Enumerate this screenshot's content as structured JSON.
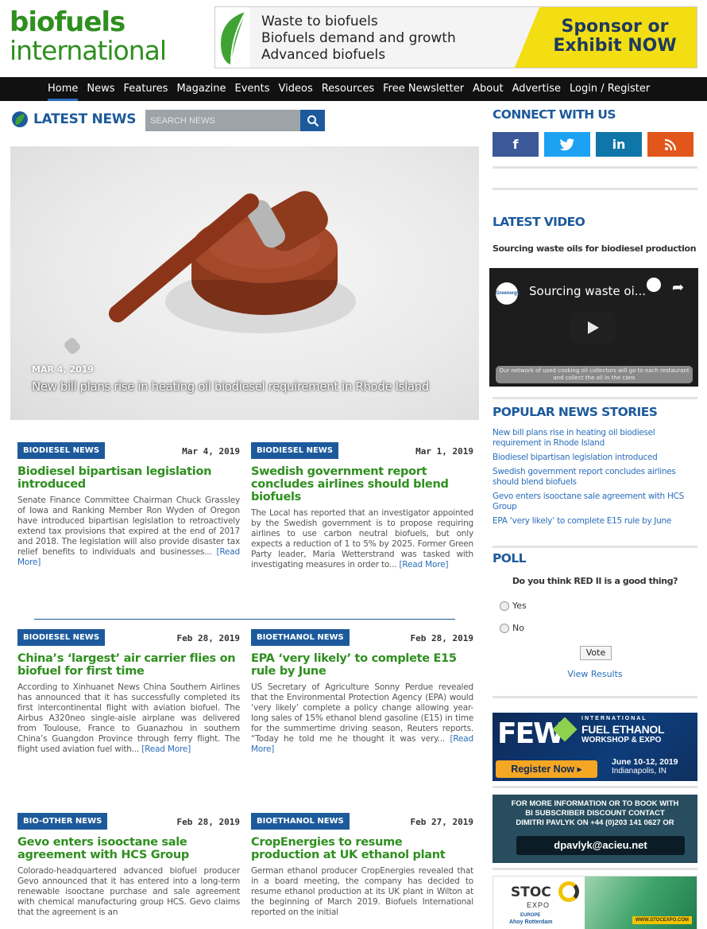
{
  "header": {
    "logo_line1": "biofuels",
    "logo_line2": "international",
    "banner_lines": [
      "Waste to biofuels",
      "Biofuels demand and growth",
      "Advanced biofuels"
    ],
    "banner_cta": "Sponsor or Exhibit NOW"
  },
  "nav": {
    "items": [
      "Home",
      "News",
      "Features",
      "Magazine",
      "Events",
      "Videos",
      "Resources",
      "Free Newsletter",
      "About",
      "Advertise",
      "Login / Register"
    ],
    "active": "Home"
  },
  "latest": {
    "title": "LATEST NEWS",
    "search_placeholder": "SEARCH NEWS"
  },
  "hero": {
    "date": "MAR 4, 2019",
    "title": "New bill plans rise in heating oil biodiesel requirement in Rhode Island"
  },
  "articles": [
    {
      "tag": "BIODIESEL NEWS",
      "date": "Mar 4, 2019",
      "title": "Biodiesel bipartisan legislation introduced",
      "body": "Senate Finance Committee Chairman Chuck Grassley of Iowa and Ranking Member Ron Wyden of Oregon have introduced bipartisan legislation to retroactively extend tax provisions that expired at the end of 2017 and 2018. The legislation will also provide disaster tax relief benefits to individuals and businesses...",
      "more": "[Read More]"
    },
    {
      "tag": "BIODIESEL NEWS",
      "date": "Mar 1, 2019",
      "title": "Swedish government report concludes airlines should blend biofuels",
      "body": "The Local has reported that an investigator appointed by the Swedish government is to propose requiring airlines to use carbon neutral biofuels, but only expects a reduction of 1 to 5% by 2025. Former Green Party leader, Maria Wetterstrand was tasked with investigating measures in order to...",
      "more": "[Read More]"
    },
    {
      "tag": "BIODIESEL NEWS",
      "date": "Feb 28, 2019",
      "title": "China’s ‘largest’ air carrier flies on biofuel for first time",
      "body": "According to Xinhuanet News China Southern Airlines has announced that it has successfully completed its first intercontinental flight with aviation biofuel. The Airbus A320neo single-aisle airplane was delivered from Toulouse, France to Guanazhou in southern China’s Guangdon Province through ferry flight. The flight used aviation fuel with...",
      "more": "[Read More]"
    },
    {
      "tag": "BIOETHANOL NEWS",
      "date": "Feb 28, 2019",
      "title": "EPA ‘very likely’ to complete E15 rule by June",
      "body": "US Secretary of Agriculture Sonny Perdue revealed that the Environmental Protection Agency (EPA) would ‘very likely’ complete a policy change allowing year-long sales of 15% ethanol blend gasoline (E15) in time for the summertime driving season, Reuters reports. “Today he told me he thought it was very...",
      "more": "[Read More]"
    },
    {
      "tag": "BIO-OTHER NEWS",
      "date": "Feb 28, 2019",
      "title": "Gevo enters isooctane sale agreement with HCS Group",
      "body": "Colorado-headquartered advanced biofuel producer Gevo announced that it has entered into a long-term renewable isooctane purchase and sale agreement with chemical manufacturing group HCS. Gevo claims that the agreement is an",
      "more": ""
    },
    {
      "tag": "BIOETHANOL NEWS",
      "date": "Feb 27, 2019",
      "title": "CropEnergies to resume production at UK ethanol plant",
      "body": "German ethanol producer CropEnergies revealed that in a board meeting, the company has decided to resume ethanol production at its UK plant in Wilton at the beginning of March 2019. Biofuels International reported on the initial",
      "more": ""
    }
  ],
  "sidebar": {
    "connect_title": "CONNECT WITH US",
    "social": [
      {
        "name": "facebook",
        "glyph": "f",
        "color": "#3b5998"
      },
      {
        "name": "twitter",
        "glyph": "🐦",
        "color": "#1da1f2"
      },
      {
        "name": "linkedin",
        "glyph": "in",
        "color": "#0e76a8"
      },
      {
        "name": "rss",
        "glyph": "⁠ ",
        "color": "#e2561b"
      }
    ],
    "video_title": "LATEST VIDEO",
    "video_subtitle": "Sourcing waste oils for biodiesel production",
    "video_player_title": "Sourcing waste oi...",
    "video_caption": "Our network of used cooking oil collectors will go to each restaurant and collect the oil in the cans",
    "popular_title": "POPULAR NEWS STORIES",
    "popular": [
      "New bill plans rise in heating oil biodiesel requirement in Rhode Island",
      "Biodiesel bipartisan legislation introduced",
      "Swedish government report concludes airlines should blend biofuels",
      "Gevo enters isooctane sale agreement with HCS Group",
      "EPA ‘very likely’ to complete E15 rule by June"
    ],
    "poll_title": "POLL",
    "poll_question": "Do you think RED II is a good thing?",
    "poll_options": [
      "Yes",
      "No"
    ],
    "vote_label": "Vote",
    "view_results": "View Results"
  },
  "ads": {
    "few": {
      "logo": "FEW",
      "line1": "INTERNATIONAL",
      "line2": "FUEL ETHANOL",
      "line3": "WORKSHOP & EXPO",
      "register": "Register Now ▸",
      "dates": "June 10-12, 2019",
      "place": "Indianapolis, IN"
    },
    "bi": {
      "l1": "FOR MORE INFORMATION OR TO BOOK WITH",
      "l2": "BI SUBSCRIBER DISCOUNT CONTACT",
      "l3": "DIMITRI PAVLYK ON +44 (0)203 141 0627 OR",
      "email": "dpavlyk@acieu.net"
    },
    "stoc": {
      "logo": "STOC",
      "expo": "EXPO",
      "region": "EUROPE",
      "venue": "Ahoy Rotterdam",
      "url": "WWW.STOCEXPO.COM"
    }
  }
}
